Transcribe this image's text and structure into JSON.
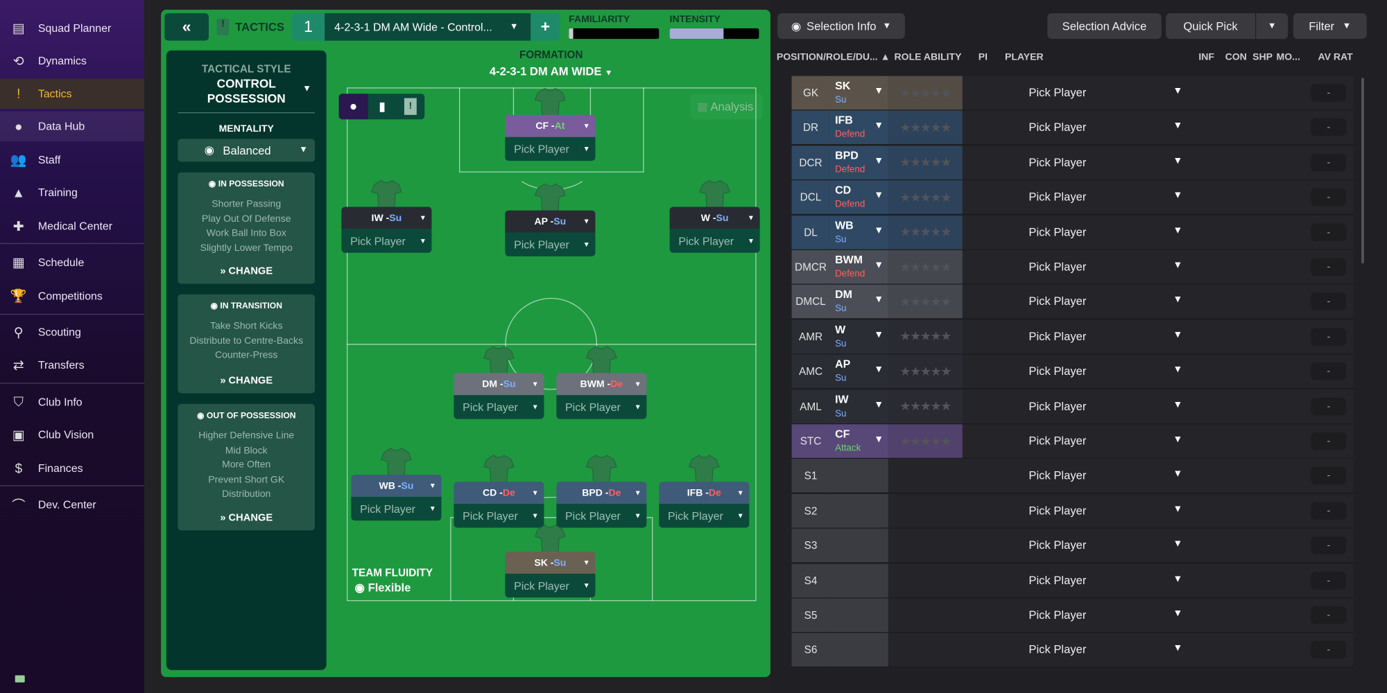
{
  "sidebar": {
    "items": [
      {
        "label": "Squad Planner",
        "icon": "clipboard-icon",
        "glyph": "▤"
      },
      {
        "label": "Dynamics",
        "icon": "dynamics-icon",
        "glyph": "⟲"
      },
      {
        "label": "Tactics",
        "icon": "tactics-icon",
        "glyph": "!",
        "active": true
      },
      {
        "label": "Data Hub",
        "icon": "data-hub-icon",
        "glyph": "●"
      },
      {
        "label": "Staff",
        "icon": "staff-icon",
        "glyph": "👥"
      },
      {
        "label": "Training",
        "icon": "training-icon",
        "glyph": "▲"
      },
      {
        "label": "Medical Center",
        "icon": "medical-icon",
        "glyph": "✚"
      },
      {
        "label": "Schedule",
        "icon": "calendar-icon",
        "glyph": "▦"
      },
      {
        "label": "Competitions",
        "icon": "trophy-icon",
        "glyph": "🏆"
      },
      {
        "label": "Scouting",
        "icon": "search-icon",
        "glyph": "⚲"
      },
      {
        "label": "Transfers",
        "icon": "transfers-icon",
        "glyph": "⇄"
      },
      {
        "label": "Club Info",
        "icon": "shield-icon",
        "glyph": "⛉"
      },
      {
        "label": "Club Vision",
        "icon": "briefcase-icon",
        "glyph": "▣"
      },
      {
        "label": "Finances",
        "icon": "money-icon",
        "glyph": "$"
      },
      {
        "label": "Dev. Center",
        "icon": "growth-icon",
        "glyph": "⌒"
      }
    ]
  },
  "topbar": {
    "tactics_label": "TACTICS",
    "slot": "1",
    "tactic_name": "4-2-3-1 DM AM Wide - Control...",
    "familiarity_label": "FAMILIARITY",
    "familiarity_level": 0.05,
    "intensity_label": "INTENSITY",
    "intensity_level": 0.6
  },
  "left": {
    "style_label": "TACTICAL STYLE",
    "style_line1": "CONTROL",
    "style_line2": "POSSESSION",
    "mentality_label": "MENTALITY",
    "mentality": "Balanced",
    "in_possession": {
      "title": "IN POSSESSION",
      "lines": [
        "Shorter Passing",
        "Play Out Of Defense",
        "Work Ball Into Box",
        "Slightly Lower Tempo"
      ]
    },
    "in_transition": {
      "title": "IN TRANSITION",
      "lines": [
        "Take Short Kicks",
        "Distribute to Centre-Backs",
        "Counter-Press"
      ]
    },
    "out_of_possession": {
      "title": "OUT OF POSSESSION",
      "lines": [
        "Higher Defensive Line",
        "Mid Block",
        "More Often",
        "Prevent Short GK",
        "Distribution"
      ]
    },
    "change_label": "CHANGE"
  },
  "pitch": {
    "formation_label": "FORMATION",
    "formation": "4-2-3-1 DM AM WIDE",
    "analysis_label": "Analysis",
    "fluidity_label": "TEAM FLUIDITY",
    "fluidity": "Flexible",
    "pick_label": "Pick Player",
    "cards": [
      {
        "role": "CF",
        "duty": "At",
        "cls": "at",
        "color": "#7a5c9c"
      },
      {
        "role": "IW",
        "duty": "Su",
        "cls": "su",
        "color": "#292b33"
      },
      {
        "role": "AP",
        "duty": "Su",
        "cls": "su",
        "color": "#292b33"
      },
      {
        "role": "W",
        "duty": "Su",
        "cls": "su",
        "color": "#292b33"
      },
      {
        "role": "DM",
        "duty": "Su",
        "cls": "su",
        "color": "#6c717b"
      },
      {
        "role": "BWM",
        "duty": "De",
        "cls": "de",
        "color": "#6c717b"
      },
      {
        "role": "WB",
        "duty": "Su",
        "cls": "su",
        "color": "#3f5b79"
      },
      {
        "role": "CD",
        "duty": "De",
        "cls": "de",
        "color": "#3f5b79"
      },
      {
        "role": "BPD",
        "duty": "De",
        "cls": "de",
        "color": "#3f5b79"
      },
      {
        "role": "IFB",
        "duty": "De",
        "cls": "de",
        "color": "#3f5b79"
      },
      {
        "role": "SK",
        "duty": "Su",
        "cls": "su",
        "color": "#6b6152"
      }
    ]
  },
  "right": {
    "selection_info": "Selection Info",
    "selection_advice": "Selection Advice",
    "quick_pick": "Quick Pick",
    "filter": "Filter",
    "headers": [
      "POSITION/ROLE/DU... ▲",
      "ROLE ABILITY",
      "PI",
      "PLAYER",
      "INF",
      "CON",
      "SHP",
      "MO...",
      "AV RAT"
    ],
    "pick_label": "Pick Player",
    "rating": "-",
    "rows": [
      {
        "pos": "GK",
        "role": "SK",
        "duty": "Su",
        "cls": "su",
        "bg": "#5b5349"
      },
      {
        "pos": "DR",
        "role": "IFB",
        "duty": "Defend",
        "cls": "de",
        "bg": "#2f4964"
      },
      {
        "pos": "DCR",
        "role": "BPD",
        "duty": "Defend",
        "cls": "de",
        "bg": "#2f4964"
      },
      {
        "pos": "DCL",
        "role": "CD",
        "duty": "Defend",
        "cls": "de",
        "bg": "#2f4964"
      },
      {
        "pos": "DL",
        "role": "WB",
        "duty": "Su",
        "cls": "su",
        "bg": "#2f4964"
      },
      {
        "pos": "DMCR",
        "role": "BWM",
        "duty": "Defend",
        "cls": "de",
        "bg": "#4b4e56"
      },
      {
        "pos": "DMCL",
        "role": "DM",
        "duty": "Su",
        "cls": "su",
        "bg": "#4b4e56"
      },
      {
        "pos": "AMR",
        "role": "W",
        "duty": "Su",
        "cls": "su",
        "bg": "#2b2d34"
      },
      {
        "pos": "AMC",
        "role": "AP",
        "duty": "Su",
        "cls": "su",
        "bg": "#2b2d34"
      },
      {
        "pos": "AML",
        "role": "IW",
        "duty": "Su",
        "cls": "su",
        "bg": "#2b2d34"
      },
      {
        "pos": "STC",
        "role": "CF",
        "duty": "Attack",
        "cls": "at",
        "bg": "#584878"
      },
      {
        "pos": "S1",
        "sub": true
      },
      {
        "pos": "S2",
        "sub": true
      },
      {
        "pos": "S3",
        "sub": true
      },
      {
        "pos": "S4",
        "sub": true
      },
      {
        "pos": "S5",
        "sub": true
      },
      {
        "pos": "S6",
        "sub": true
      }
    ]
  }
}
